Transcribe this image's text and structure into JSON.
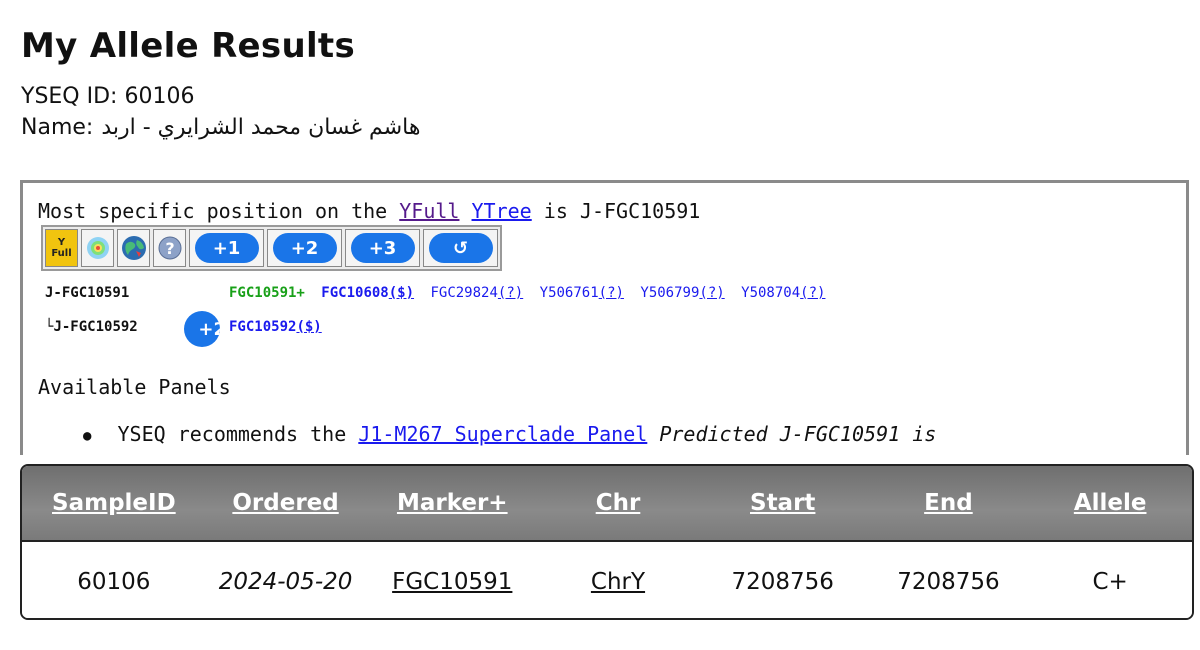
{
  "header": {
    "title": "My Allele Results",
    "yseq_id_label": "YSEQ ID:",
    "yseq_id": "60106",
    "name_label": "Name:",
    "name": "هاشم غسان محمد الشرايري - اربد"
  },
  "tree": {
    "most_specific_prefix": "Most specific position on the",
    "yfull_link": "YFull",
    "ytree_link": "YTree",
    "is_text": "is",
    "position": "J-FGC10591",
    "icons": [
      {
        "name": "yfull-icon",
        "label_top": "Y",
        "label_bottom": "Full"
      },
      {
        "name": "heatmap-icon"
      },
      {
        "name": "globe-icon"
      },
      {
        "name": "help-icon",
        "glyph": "?"
      }
    ],
    "buttons": [
      "+1",
      "+2",
      "+3",
      "↺"
    ],
    "clade_1": "J-FGC10591",
    "clade_1_snps": [
      {
        "text": "FGC10591+",
        "style": "green"
      },
      {
        "text": "FGC10608",
        "style": "bold-blue",
        "suffix": "($)"
      },
      {
        "text": "FGC29824",
        "style": "plain-blue",
        "suffix": "(?)"
      },
      {
        "text": "Y506761",
        "style": "plain-blue",
        "suffix": "(?)"
      },
      {
        "text": "Y506799",
        "style": "plain-blue",
        "suffix": "(?)"
      },
      {
        "text": "Y508704",
        "style": "plain-blue",
        "suffix": "(?)"
      }
    ],
    "clade_2_prefix": "└",
    "clade_2": "J-FGC10592",
    "clade_2_button": "+2",
    "clade_2_snp": "FGC10592",
    "clade_2_snp_suffix": "($)",
    "available_panels_heading": "Available Panels",
    "panel_recommend_prefix": "YSEQ recommends the",
    "panel_link": "J1-M267 Superclade Panel",
    "panel_predicted": "Predicted J-FGC10591 is"
  },
  "table": {
    "columns": [
      "SampleID",
      "Ordered",
      "Marker+",
      "Chr",
      "Start",
      "End",
      "Allele"
    ],
    "rows": [
      [
        "60106",
        "2024-05-20",
        "FGC10591",
        "ChrY",
        "7208756",
        "7208756",
        "C+"
      ]
    ]
  },
  "colors": {
    "accent_blue": "#1a75e8",
    "link_blue": "#1a1aee",
    "visited_purple": "#551a8b",
    "positive_green": "#18a018",
    "header_gray": "#7a7a7a"
  }
}
